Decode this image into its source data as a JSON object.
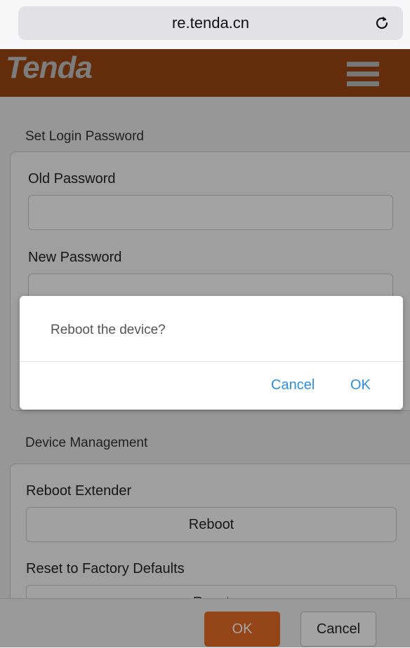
{
  "browser": {
    "url": "re.tenda.cn",
    "reload_icon": "reload-icon"
  },
  "header": {
    "logo_text": "Tenda",
    "menu_icon": "hamburger-menu-icon",
    "brand_color": "#9a4513"
  },
  "login_section": {
    "title": "Set Login Password",
    "old_password_label": "Old Password",
    "new_password_label": "New Password"
  },
  "device_section": {
    "title": "Device Management",
    "reboot_label": "Reboot Extender",
    "reboot_button": "Reboot",
    "reset_label": "Reset to Factory Defaults",
    "reset_button": "Reset"
  },
  "footer": {
    "ok_label": "OK",
    "cancel_label": "Cancel",
    "ok_color": "#e46a24"
  },
  "dialog": {
    "message": "Reboot the device?",
    "cancel_label": "Cancel",
    "ok_label": "OK",
    "link_color": "#2f8ed8"
  }
}
